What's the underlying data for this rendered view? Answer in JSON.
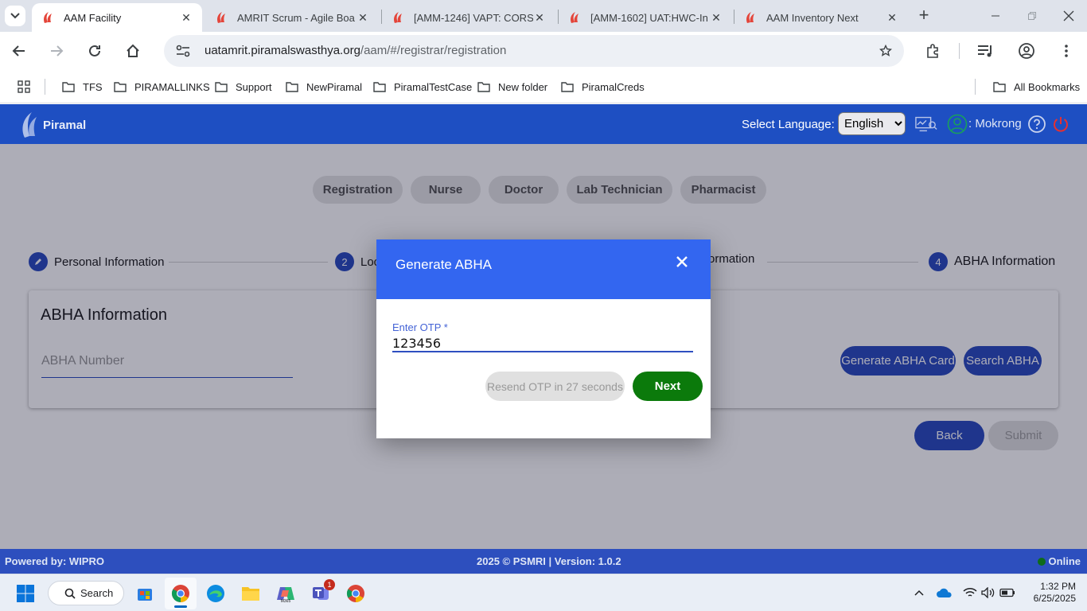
{
  "browser": {
    "tabs": [
      {
        "title": "AAM Facility",
        "active": true
      },
      {
        "title": "AMRIT Scrum - Agile Boa",
        "active": false
      },
      {
        "title": "[AMM-1246] VAPT: CORS",
        "active": false
      },
      {
        "title": "[AMM-1602] UAT:HWC-In",
        "active": false
      },
      {
        "title": "AAM Inventory Next",
        "active": false
      }
    ],
    "url_host": "uatamrit.piramalswasthya.org",
    "url_path": "/aam/#/registrar/registration",
    "bookmarks": [
      "TFS",
      "PIRAMALLINKS",
      "Support",
      "NewPiramal",
      "PiramalTestCase",
      "New folder",
      "PiramalCreds"
    ],
    "all_bookmarks": "All Bookmarks"
  },
  "app": {
    "logo_text": "Piramal",
    "select_language_label": "Select Language:",
    "language_selected": "English",
    "user_name": ": Mokrong",
    "roles": [
      "Registration",
      "Nurse",
      "Doctor",
      "Lab Technician",
      "Pharmacist"
    ],
    "steps": [
      {
        "num": "",
        "label": "Personal Information"
      },
      {
        "num": "2",
        "label": "Loc"
      },
      {
        "num": "",
        "label": "ormation"
      },
      {
        "num": "4",
        "label": "ABHA Information"
      }
    ],
    "abha_section_title": "ABHA Information",
    "abha_number_placeholder": "ABHA Number",
    "generate_abha_card": "Generate ABHA Card",
    "search_abha": "Search ABHA",
    "back": "Back",
    "submit": "Submit",
    "footer_powered": "Powered by: WIPRO",
    "footer_center": "2025 © PSMRI  |  Version: 1.0.2",
    "footer_status": "Online"
  },
  "modal": {
    "title": "Generate ABHA",
    "otp_label": "Enter OTP *",
    "otp_value": "123456",
    "resend_label": "Resend OTP in 27 seconds",
    "next_label": "Next"
  },
  "taskbar": {
    "search_label": "Search",
    "teams_badge": "1",
    "time": "1:32 PM",
    "date": "6/25/2025"
  },
  "colors": {
    "header_blue": "#1e4fc2",
    "modal_header": "#3366f0",
    "next_green": "#0b7a0b",
    "primary_button": "#2f4fc0"
  }
}
